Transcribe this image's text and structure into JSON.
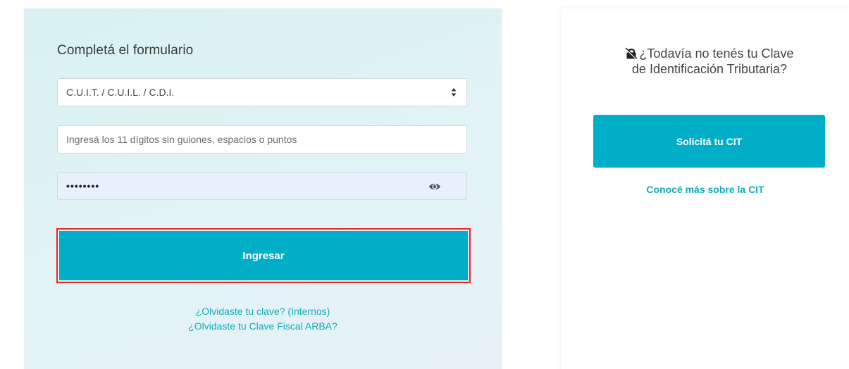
{
  "login_form": {
    "title": "Completá el formulario",
    "document_select": {
      "selected": "C.U.I.T. / C.U.I.L. / C.D.I."
    },
    "document_input": {
      "value": "",
      "placeholder": "Ingresá los 11 dígitos sin guiones, espacios o puntos"
    },
    "password_input": {
      "value": "••••••••"
    },
    "submit_label": "Ingresar",
    "links": [
      "¿Olvidaste tu clave? (Internos)",
      "¿Olvidaste tu Clave Fiscal ARBA?"
    ]
  },
  "cit_panel": {
    "question_line1": "¿Todavía no tenés tu Clave",
    "question_line2": "de Identificación Tributaria?",
    "button_label": "Solicitá tu CIT",
    "link_label": "Conocé más sobre la CIT"
  },
  "colors": {
    "accent": "#00aec7",
    "link": "#11aab9",
    "highlight_border": "#e8272b"
  },
  "icons": {
    "lock": "lock-icon",
    "eye": "eye-icon",
    "select_arrows": "select-arrows-icon"
  }
}
